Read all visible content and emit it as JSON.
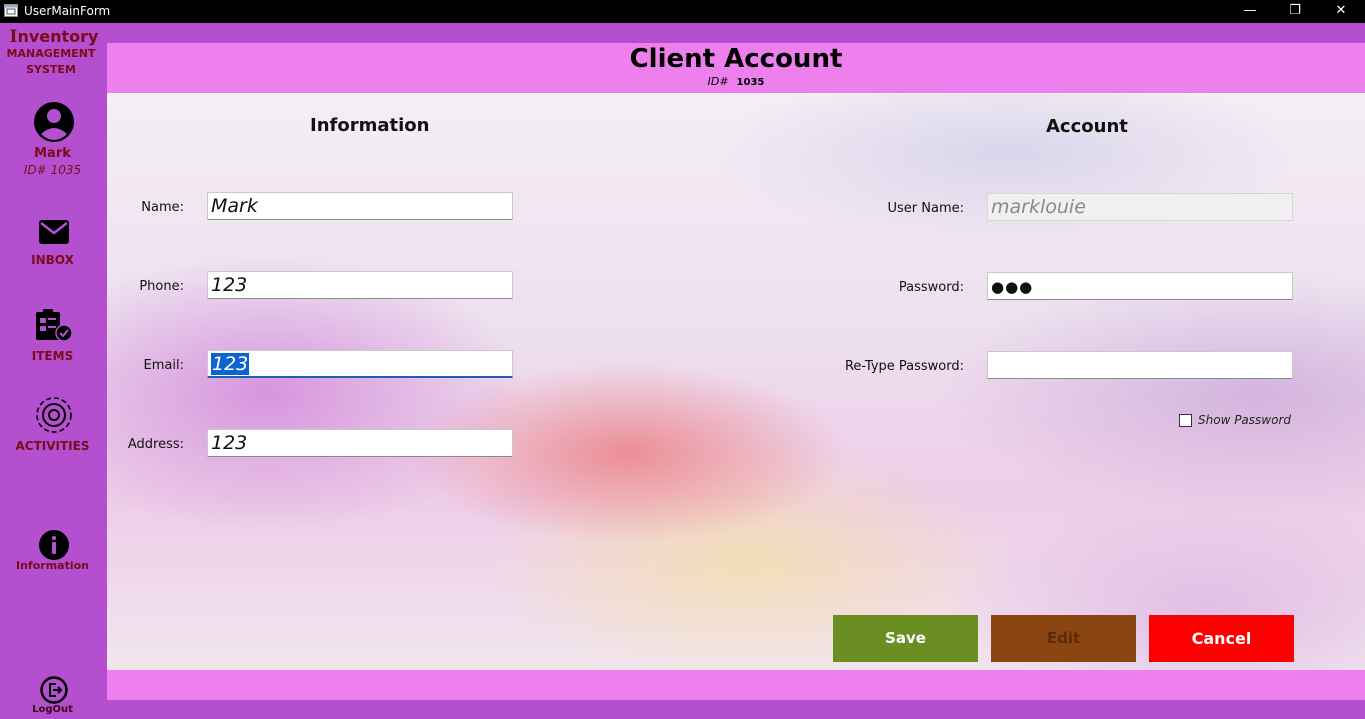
{
  "window": {
    "title": "UserMainForm",
    "minimize": "—",
    "restore": "❐",
    "close": "✕"
  },
  "logo": {
    "line1_initial": "I",
    "line1_rest": "nventory",
    "line2": "MANAGEMENT",
    "line3": "SYSTEM"
  },
  "user": {
    "name": "Mark",
    "id_label": "ID#",
    "id_value": "1035"
  },
  "nav": {
    "inbox": "INBOX",
    "items": "ITEMS",
    "activities": "ACTIVITIES",
    "information": "Information",
    "logout": "LogOut"
  },
  "header": {
    "title": "Client Account",
    "id_label": "ID#",
    "id_value": "1035"
  },
  "information": {
    "title": "Information",
    "name_label": "Name:",
    "name_value": "Mark",
    "phone_label": "Phone:",
    "phone_value": "123",
    "email_label": "Email:",
    "email_value": "123",
    "address_label": "Address:",
    "address_value": "123"
  },
  "account": {
    "title": "Account",
    "username_label": "User Name:",
    "username_value": "marklouie",
    "password_label": "Password:",
    "password_value": "●●●",
    "retype_label": "Re-Type Password:",
    "retype_value": "",
    "show_password_label": "Show Password",
    "show_password_checked": false
  },
  "buttons": {
    "save": "Save",
    "edit": "Edit",
    "cancel": "Cancel"
  },
  "colors": {
    "sidebar": "#b44fd0",
    "header": "#ee80ee",
    "brand_text": "#7a0b1a",
    "save": "#6b8e23",
    "edit": "#8b4513",
    "cancel": "#ff0000"
  }
}
